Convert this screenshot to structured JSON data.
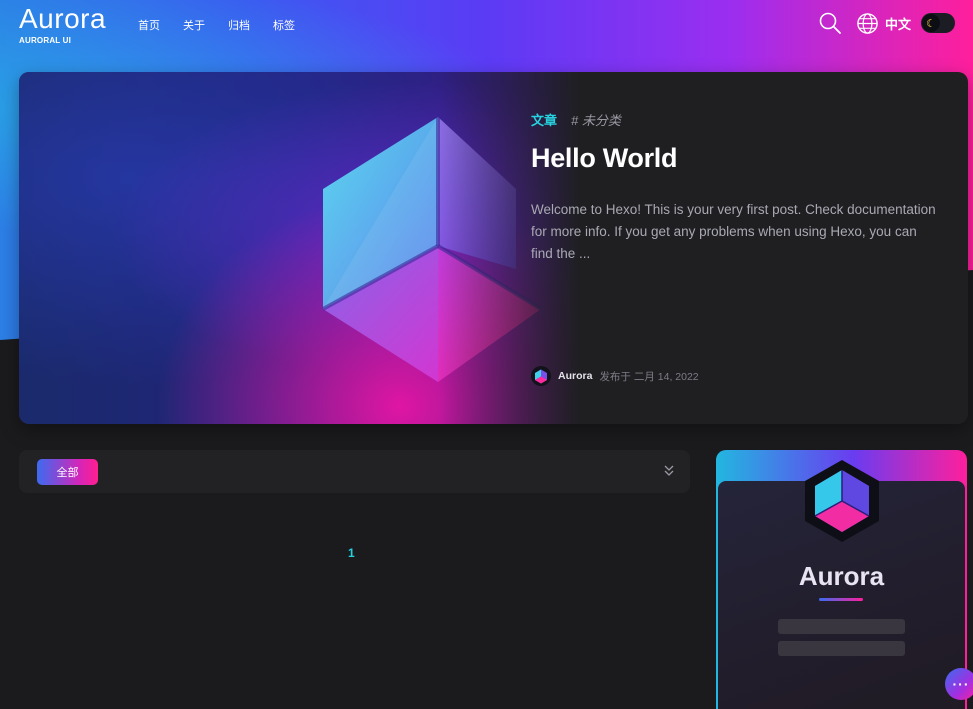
{
  "header": {
    "logo_title": "Aurora",
    "logo_subtitle": "AURORAL UI",
    "nav": [
      "首页",
      "关于",
      "归档",
      "标签"
    ],
    "language_label": "中文",
    "theme_icon": "moon-icon"
  },
  "hero": {
    "category": "文章",
    "tag": "# 未分类",
    "title": "Hello World",
    "excerpt": "Welcome to Hexo! This is your very first post. Check documentation for more info. If you get any problems when using Hexo, you can find the ...",
    "author": "Aurora",
    "publish_date": "发布于 二月 14, 2022"
  },
  "filter": {
    "active_label": "全部",
    "expand_icon": "chevrons-down-icon"
  },
  "pagination": {
    "current_page": "1"
  },
  "profile": {
    "name": "Aurora"
  },
  "floating": {
    "label": "···"
  },
  "colors": {
    "accent_cyan": "#27d2e0",
    "accent_pink": "#ff1f9c",
    "accent_blue": "#3b6bf0",
    "background": "#1b1b1d"
  }
}
